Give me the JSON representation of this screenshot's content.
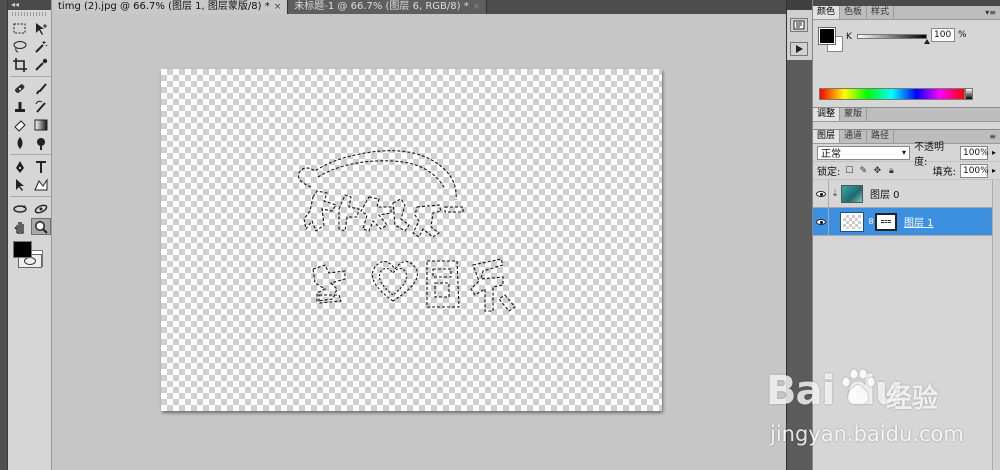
{
  "document_tabs": [
    {
      "title": "timg (2).jpg @ 66.7% (图层 1, 图层蒙版/8) *",
      "close": "×",
      "active": true
    },
    {
      "title": "未标题-1 @ 66.7% (图层 6, RGB/8) *",
      "close": "×",
      "active": false
    }
  ],
  "toolbox": {
    "collapse_glyph": "◂◂",
    "tools": [
      {
        "name": "rectangular-marquee-icon"
      },
      {
        "name": "move-icon"
      },
      {
        "name": "lasso-icon"
      },
      {
        "name": "magic-wand-icon"
      },
      {
        "name": "crop-icon"
      },
      {
        "name": "eyedropper-icon"
      },
      {
        "name": "healing-brush-icon"
      },
      {
        "name": "brush-icon"
      },
      {
        "name": "clone-stamp-icon"
      },
      {
        "name": "history-brush-icon"
      },
      {
        "name": "eraser-icon"
      },
      {
        "name": "gradient-icon"
      },
      {
        "name": "blur-icon"
      },
      {
        "name": "burn-icon"
      },
      {
        "name": "pen-icon"
      },
      {
        "name": "type-icon"
      },
      {
        "name": "path-selection-icon"
      },
      {
        "name": "custom-shape-icon"
      },
      {
        "name": "3d-rotate-icon"
      },
      {
        "name": "3d-orbit-icon"
      },
      {
        "name": "hand-icon"
      },
      {
        "name": "zoom-icon"
      }
    ],
    "active_tool": "zoom-icon",
    "foreground_color": "#000000",
    "background_color": "#ffffff"
  },
  "color_panel": {
    "tabs": [
      "颜色",
      "色板",
      "样式"
    ],
    "channel_label": "K",
    "channel_value": "100",
    "unit": "%"
  },
  "adjust_panel": {
    "tabs": [
      "调整",
      "蒙版"
    ]
  },
  "layers_panel": {
    "tabs": [
      "图层",
      "通道",
      "路径"
    ],
    "blend_mode": "正常",
    "opacity_label": "不透明度:",
    "opacity_value": "100%",
    "lock_label": "锁定:",
    "fill_label": "填充:",
    "fill_value": "100%",
    "layers": [
      {
        "name": "图层 0",
        "visible": true,
        "selected": false,
        "thumbnail": "teal-image"
      },
      {
        "name": "图层 1",
        "visible": true,
        "selected": true,
        "thumbnail": "transparent-with-mask"
      }
    ]
  },
  "watermark": {
    "logo": "Bai  du",
    "brand_cn": "经验",
    "url": "jingyan.baidu.com"
  }
}
